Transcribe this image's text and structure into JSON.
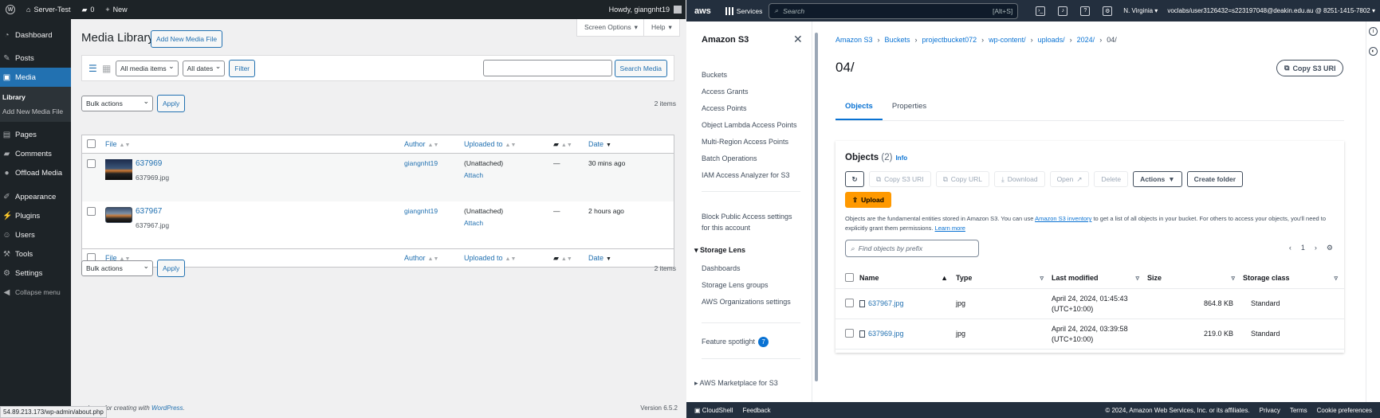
{
  "wp": {
    "adminbar": {
      "site": "Server-Test",
      "comments": "0",
      "new": "New",
      "howdy": "Howdy, giangnht19"
    },
    "menu": {
      "dashboard": "Dashboard",
      "posts": "Posts",
      "media": "Media",
      "library": "Library",
      "add_new": "Add New Media File",
      "pages": "Pages",
      "comments": "Comments",
      "offload": "Offload Media",
      "appearance": "Appearance",
      "plugins": "Plugins",
      "users": "Users",
      "tools": "Tools",
      "settings": "Settings",
      "collapse": "Collapse menu"
    },
    "screen_options": "Screen Options",
    "help": "Help",
    "title": "Media Library",
    "add_new_btn": "Add New Media File",
    "filter": {
      "type": "All media items",
      "date": "All dates",
      "filter_btn": "Filter",
      "search_btn": "Search Media"
    },
    "bulk": {
      "label": "Bulk actions",
      "apply": "Apply"
    },
    "count": "2 items",
    "columns": {
      "file": "File",
      "author": "Author",
      "uploaded": "Uploaded to",
      "date": "Date"
    },
    "rows": [
      {
        "title": "637969",
        "file": "637969.jpg",
        "author": "giangnht19",
        "uploaded": "(Unattached)",
        "attach": "Attach",
        "comments": "—",
        "date": "30 mins ago"
      },
      {
        "title": "637967",
        "file": "637967.jpg",
        "author": "giangnht19",
        "uploaded": "(Unattached)",
        "attach": "Attach",
        "comments": "—",
        "date": "2 hours ago"
      }
    ],
    "footer_text": "ank you for creating with",
    "footer_link": "WordPress",
    "version": "Version 6.5.2",
    "status_url": "54.89.213.173/wp-admin/about.php"
  },
  "aws": {
    "topbar": {
      "logo": "aws",
      "services": "Services",
      "search_placeholder": "Search",
      "shortcut": "[Alt+S]",
      "region": "N. Virginia",
      "account": "voclabs/user3126432=s223197048@deakin.edu.au @ 8251-1415-7802"
    },
    "nav": {
      "title": "Amazon S3",
      "items": [
        "Buckets",
        "Access Grants",
        "Access Points",
        "Object Lambda Access Points",
        "Multi-Region Access Points",
        "Batch Operations",
        "IAM Access Analyzer for S3"
      ],
      "block_public": "Block Public Access settings for this account",
      "storage_lens": "Storage Lens",
      "lens_items": [
        "Dashboards",
        "Storage Lens groups",
        "AWS Organizations settings"
      ],
      "feature_spotlight": "Feature spotlight",
      "spotlight_count": "7",
      "marketplace": "AWS Marketplace for S3"
    },
    "breadcrumb": [
      "Amazon S3",
      "Buckets",
      "projectbucket072",
      "wp-content/",
      "uploads/",
      "2024/",
      "04/"
    ],
    "title": "04/",
    "copy_s3_uri": "Copy S3 URI",
    "tabs": [
      "Objects",
      "Properties"
    ],
    "objects": {
      "heading": "Objects",
      "count": "(2)",
      "info": "Info",
      "buttons": {
        "copy_uri": "Copy S3 URI",
        "copy_url": "Copy URL",
        "download": "Download",
        "open": "Open",
        "delete": "Delete",
        "actions": "Actions",
        "create_folder": "Create folder",
        "upload": "Upload"
      },
      "desc1": "Objects are the fundamental entities stored in Amazon S3. You can use",
      "desc_link": "Amazon S3 inventory",
      "desc2": "to get a list of all objects in your bucket. For others to access your objects, you'll need to explicitly grant them permissions.",
      "learn_more": "Learn more",
      "find_placeholder": "Find objects by prefix",
      "page": "1",
      "columns": {
        "name": "Name",
        "type": "Type",
        "last_modified": "Last modified",
        "size": "Size",
        "storage_class": "Storage class"
      },
      "rows": [
        {
          "name": "637967.jpg",
          "type": "jpg",
          "modified1": "April 24, 2024, 01:45:43",
          "modified2": "(UTC+10:00)",
          "size": "864.8 KB",
          "class": "Standard"
        },
        {
          "name": "637969.jpg",
          "type": "jpg",
          "modified1": "April 24, 2024, 03:39:58",
          "modified2": "(UTC+10:00)",
          "size": "219.0 KB",
          "class": "Standard"
        }
      ]
    },
    "footer": {
      "cloudshell": "CloudShell",
      "feedback": "Feedback",
      "copyright": "© 2024, Amazon Web Services, Inc. or its affiliates.",
      "privacy": "Privacy",
      "terms": "Terms",
      "cookie": "Cookie preferences"
    }
  }
}
